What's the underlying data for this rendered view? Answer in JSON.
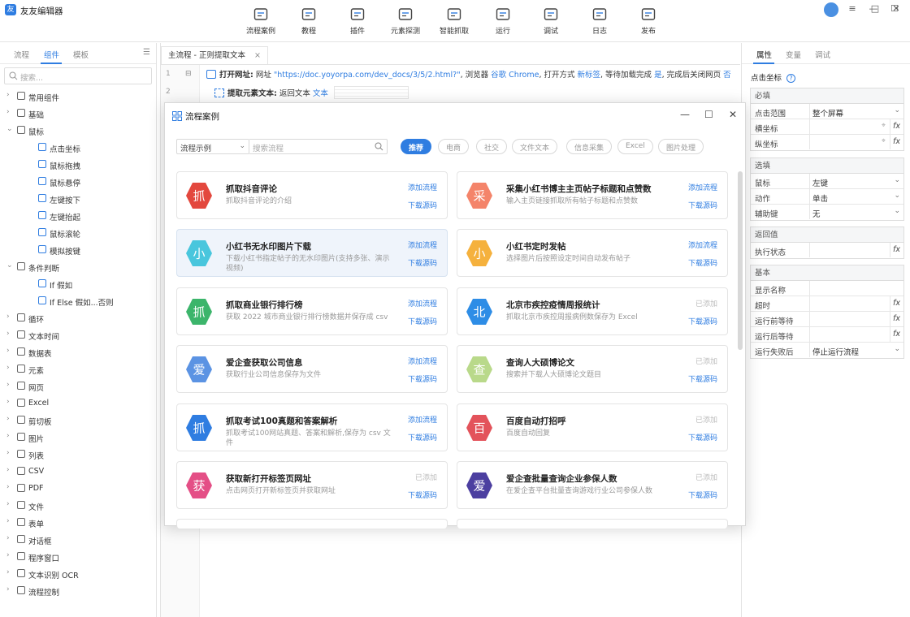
{
  "app": {
    "title": "友友编辑器"
  },
  "toolbar": [
    {
      "label": "流程案例",
      "icon": "grid-icon"
    },
    {
      "label": "教程",
      "icon": "play-screen-icon"
    },
    {
      "label": "插件",
      "icon": "plugin-icon"
    },
    {
      "label": "元素探测",
      "icon": "element-detect-icon"
    },
    {
      "label": "智能抓取",
      "icon": "smart-grab-icon"
    },
    {
      "label": "运行",
      "icon": "run-icon"
    },
    {
      "label": "调试",
      "icon": "debug-icon"
    },
    {
      "label": "日志",
      "icon": "log-icon"
    },
    {
      "label": "发布",
      "icon": "publish-icon"
    }
  ],
  "left_panel": {
    "tabs": [
      "流程",
      "组件",
      "模板"
    ],
    "active_tab": "组件",
    "search_placeholder": "搜索...",
    "tree": [
      {
        "label": "常用组件",
        "level": 0,
        "expanded": false
      },
      {
        "label": "基础",
        "level": 0,
        "expanded": false
      },
      {
        "label": "鼠标",
        "level": 0,
        "expanded": true
      },
      {
        "label": "点击坐标",
        "level": 1
      },
      {
        "label": "鼠标拖拽",
        "level": 1
      },
      {
        "label": "鼠标悬停",
        "level": 1
      },
      {
        "label": "左键按下",
        "level": 1
      },
      {
        "label": "左键抬起",
        "level": 1
      },
      {
        "label": "鼠标滚轮",
        "level": 1
      },
      {
        "label": "模拟按键",
        "level": 1
      },
      {
        "label": "条件判断",
        "level": 0,
        "expanded": true
      },
      {
        "label": "If 假如",
        "level": 1
      },
      {
        "label": "If Else 假如...否则",
        "level": 1
      },
      {
        "label": "循环",
        "level": 0,
        "expanded": false
      },
      {
        "label": "文本时间",
        "level": 0,
        "expanded": false
      },
      {
        "label": "数据表",
        "level": 0,
        "expanded": false
      },
      {
        "label": "元素",
        "level": 0,
        "expanded": false
      },
      {
        "label": "网页",
        "level": 0,
        "expanded": false
      },
      {
        "label": "Excel",
        "level": 0,
        "expanded": false
      },
      {
        "label": "剪切板",
        "level": 0,
        "expanded": false
      },
      {
        "label": "图片",
        "level": 0,
        "expanded": false
      },
      {
        "label": "列表",
        "level": 0,
        "expanded": false
      },
      {
        "label": "CSV",
        "level": 0,
        "expanded": false
      },
      {
        "label": "PDF",
        "level": 0,
        "expanded": false
      },
      {
        "label": "文件",
        "level": 0,
        "expanded": false
      },
      {
        "label": "表单",
        "level": 0,
        "expanded": false
      },
      {
        "label": "对话框",
        "level": 0,
        "expanded": false
      },
      {
        "label": "程序窗口",
        "level": 0,
        "expanded": false
      },
      {
        "label": "文本识别 OCR",
        "level": 0,
        "expanded": false
      },
      {
        "label": "流程控制",
        "level": 0,
        "expanded": false
      }
    ]
  },
  "editor": {
    "tab_title": "主流程 - 正则提取文本",
    "lines": [
      {
        "no": "1",
        "cmd": "打开网址:",
        "text_a": " 网址 ",
        "url": "\"https://doc.yoyorpa.com/dev_docs/3/5/2.html?\"",
        "text_b": ", 浏览器 ",
        "browser": "谷歌 Chrome",
        "text_c": ", 打开方式 ",
        "mode": "新标签",
        "text_d": ", 等待加载完成 ",
        "wait": "是",
        "text_e": ", 完成后关闭网页 ",
        "close": "否"
      },
      {
        "no": "2",
        "cmd": "提取元素文本:",
        "text_a": " 返回文本 ",
        "url": "文本"
      }
    ]
  },
  "right_panel": {
    "tabs": [
      "属性",
      "变量",
      "调试"
    ],
    "active_tab": "属性",
    "title": "点击坐标",
    "sections": [
      {
        "title": "必填",
        "rows": [
          {
            "key": "点击范围",
            "value": "整个屏幕",
            "type": "select"
          },
          {
            "key": "横坐标",
            "value": "",
            "type": "fx-target"
          },
          {
            "key": "纵坐标",
            "value": "",
            "type": "fx-target"
          }
        ]
      },
      {
        "title": "选填",
        "rows": [
          {
            "key": "鼠标",
            "value": "左键",
            "type": "select"
          },
          {
            "key": "动作",
            "value": "单击",
            "type": "select"
          },
          {
            "key": "辅助键",
            "value": "无",
            "type": "select"
          }
        ]
      },
      {
        "title": "返回值",
        "rows": [
          {
            "key": "执行状态",
            "value": "",
            "type": "fx"
          }
        ]
      },
      {
        "title": "基本",
        "rows": [
          {
            "key": "显示名称",
            "value": "",
            "type": "text"
          },
          {
            "key": "超时",
            "value": "",
            "type": "fx"
          },
          {
            "key": "运行前等待",
            "value": "",
            "type": "fx"
          },
          {
            "key": "运行后等待",
            "value": "",
            "type": "fx"
          },
          {
            "key": "运行失败后",
            "value": "停止运行流程",
            "type": "select"
          }
        ]
      }
    ]
  },
  "modal": {
    "title": "流程案例",
    "filter_select": "流程示例",
    "search_placeholder": "搜索流程",
    "chips": [
      "推荐",
      "电商",
      "社交",
      "文件文本",
      "信息采集",
      "Excel",
      "图片处理"
    ],
    "active_chip": "推荐",
    "add_label": "添加流程",
    "added_label": "已添加",
    "download_label": "下载源码",
    "cards": [
      {
        "char": "抓",
        "color": "#e3483e",
        "title": "抓取抖音评论",
        "desc": "抓取抖音评论的介绍",
        "added": false
      },
      {
        "char": "采",
        "color": "#f4846a",
        "title": "采集小红书博主主页帖子标题和点赞数",
        "desc": "输入主页链接抓取所有帖子标题和点赞数",
        "added": false
      },
      {
        "char": "小",
        "color": "#49c6dd",
        "title": "小红书无水印图片下载",
        "desc": "下载小红书指定帖子的无水印图片(支持多张、演示视频)",
        "added": false
      },
      {
        "char": "小",
        "color": "#f5b13d",
        "title": "小红书定时发帖",
        "desc": "选择图片后按照设定时间自动发布帖子",
        "added": false
      },
      {
        "char": "抓",
        "color": "#3cb56b",
        "title": "抓取商业银行排行榜",
        "desc": "获取 2022 城市商业银行排行榜数据并保存成 csv",
        "added": false
      },
      {
        "char": "北",
        "color": "#2e8de6",
        "title": "北京市疾控疫情周报统计",
        "desc": "抓取北京市疾控周报病例数保存为 Excel",
        "added": true
      },
      {
        "char": "爱",
        "color": "#5b93e3",
        "title": "爱企查获取公司信息",
        "desc": "获取行业公司信息保存为文件",
        "added": false
      },
      {
        "char": "查",
        "color": "#b9d98a",
        "title": "查询人大硕博论文",
        "desc": "搜索并下载人大硕博论文题目",
        "added": true
      },
      {
        "char": "抓",
        "color": "#2f7de1",
        "title": "抓取考试100真题和答案解析",
        "desc": "抓取考试100网站真题、答案和解析,保存为 csv 文件",
        "added": false
      },
      {
        "char": "百",
        "color": "#e3535b",
        "title": "百度自动打招呼",
        "desc": "百度自动回复",
        "added": true
      },
      {
        "char": "获",
        "color": "#e44f86",
        "title": "获取新打开标签页网址",
        "desc": "点击网页打开新标签页并获取网址",
        "added": true
      },
      {
        "char": "爱",
        "color": "#4c3fa0",
        "title": "爱企查批量查询企业参保人数",
        "desc": "在爱企查平台批量查询游戏行业公司参保人数",
        "added": true
      }
    ]
  }
}
